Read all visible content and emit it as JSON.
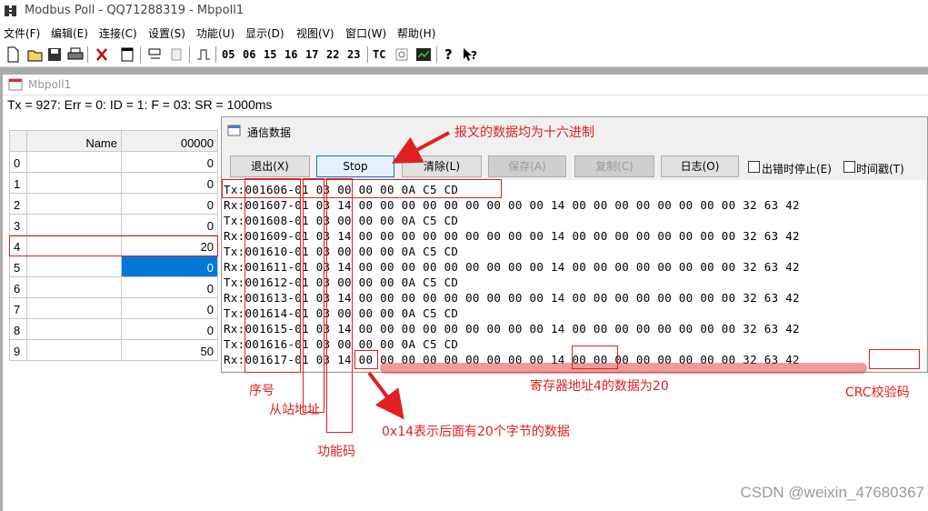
{
  "window": {
    "title": "Modbus Poll - QQ71288319 - Mbpoll1"
  },
  "menu": [
    "文件(F)",
    "编辑(E)",
    "连接(C)",
    "设置(S)",
    "功能(U)",
    "显示(D)",
    "视图(V)",
    "窗口(W)",
    "帮助(H)"
  ],
  "toolbar": {
    "function_codes": [
      "05",
      "06",
      "15",
      "16",
      "17",
      "22",
      "23"
    ],
    "tc_label": "TC"
  },
  "child": {
    "title": "Mbpoll1",
    "status": "Tx = 927: Err = 0: ID = 1: F = 03: SR = 1000ms",
    "grid": {
      "headers": [
        "Name",
        "00000"
      ],
      "rows": [
        {
          "idx": "0",
          "name": "",
          "value": "0"
        },
        {
          "idx": "1",
          "name": "",
          "value": "0"
        },
        {
          "idx": "2",
          "name": "",
          "value": "0"
        },
        {
          "idx": "3",
          "name": "",
          "value": "0"
        },
        {
          "idx": "4",
          "name": "",
          "value": "20"
        },
        {
          "idx": "5",
          "name": "",
          "value": "0"
        },
        {
          "idx": "6",
          "name": "",
          "value": "0"
        },
        {
          "idx": "7",
          "name": "",
          "value": "0"
        },
        {
          "idx": "8",
          "name": "",
          "value": "0"
        },
        {
          "idx": "9",
          "name": "",
          "value": "50"
        }
      ]
    }
  },
  "dialog": {
    "title": "通信数据",
    "buttons": {
      "exit": "退出(X)",
      "stop": "Stop",
      "clear": "清除(L)",
      "save": "保存(A)",
      "copy": "复制(C)",
      "log": "日志(O)"
    },
    "checkboxes": {
      "stop_on_error": "出错时停止(E)",
      "timestamp": "时间戳(T)"
    },
    "log": [
      "Tx:001606-01 03 00 00 00 0A C5 CD",
      "Rx:001607-01 03 14 00 00 00 00 00 00 00 00 00 14 00 00 00 00 00 00 00 00 32 63 42",
      "Tx:001608-01 03 00 00 00 0A C5 CD",
      "Rx:001609-01 03 14 00 00 00 00 00 00 00 00 00 14 00 00 00 00 00 00 00 00 32 63 42",
      "Tx:001610-01 03 00 00 00 0A C5 CD",
      "Rx:001611-01 03 14 00 00 00 00 00 00 00 00 00 14 00 00 00 00 00 00 00 00 32 63 42",
      "Tx:001612-01 03 00 00 00 0A C5 CD",
      "Rx:001613-01 03 14 00 00 00 00 00 00 00 00 00 14 00 00 00 00 00 00 00 00 32 63 42",
      "Tx:001614-01 03 00 00 00 0A C5 CD",
      "Rx:001615-01 03 14 00 00 00 00 00 00 00 00 00 14 00 00 00 00 00 00 00 00 32 63 42",
      "Tx:001616-01 03 00 00 00 0A C5 CD",
      "Rx:001617-01 03 14 00 00 00 00 00 00 00 00 00 14 00 00 00 00 00 00 00 00 32 63 42"
    ]
  },
  "annotations": {
    "hex_note": "报文的数据均为十六进制",
    "seq": "序号",
    "slave_addr": "从站地址",
    "func_code": "功能码",
    "byte_count": "0x14表示后面有20个字节的数据",
    "register_note": "寄存器地址4的数据为20",
    "crc": "CRC校验码"
  },
  "watermark": "CSDN @weixin_47680367",
  "colors": {
    "annotation": "#e02020",
    "selection": "#0078d7"
  }
}
